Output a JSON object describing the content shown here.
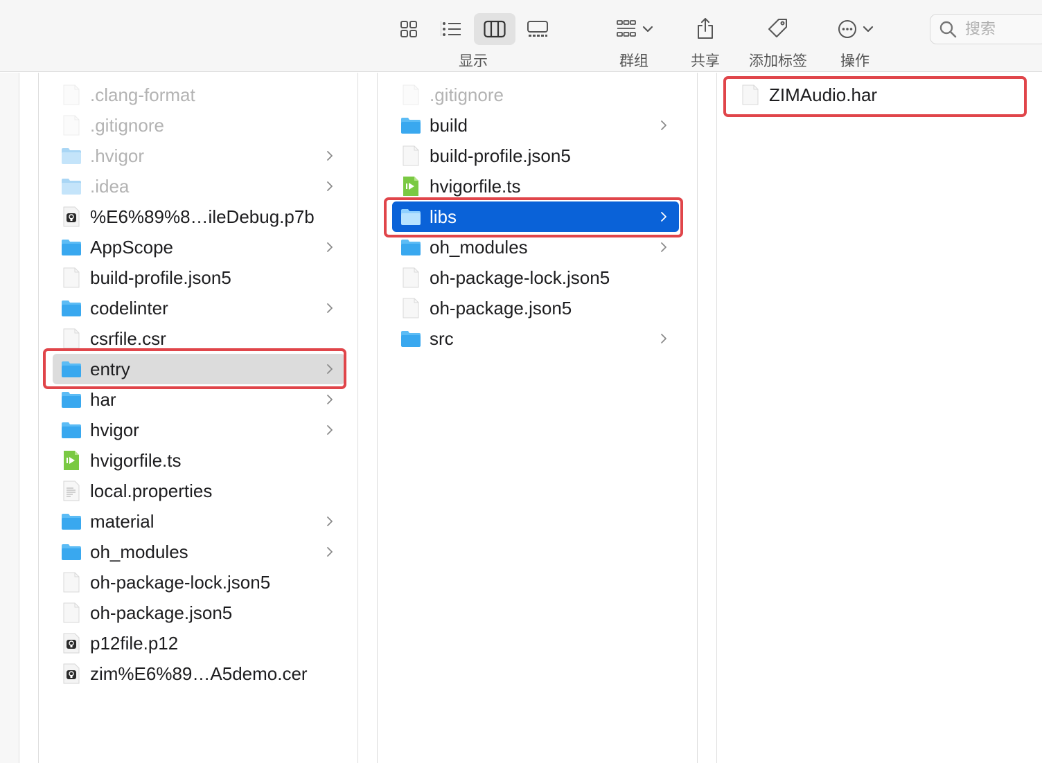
{
  "toolbar": {
    "view_label": "显示",
    "group_label": "群组",
    "share_label": "共享",
    "tag_label": "添加标签",
    "action_label": "操作",
    "search_placeholder": "搜索"
  },
  "columns": [
    {
      "items": [
        {
          "name": ".clang-format",
          "kind": "file",
          "dim": true
        },
        {
          "name": ".gitignore",
          "kind": "file",
          "dim": true
        },
        {
          "name": ".hvigor",
          "kind": "folder",
          "dim": true,
          "chevron": true
        },
        {
          "name": ".idea",
          "kind": "folder",
          "dim": true,
          "chevron": true
        },
        {
          "name": "%E6%89%8…ileDebug.p7b",
          "kind": "cert"
        },
        {
          "name": "AppScope",
          "kind": "folder",
          "chevron": true
        },
        {
          "name": "build-profile.json5",
          "kind": "file"
        },
        {
          "name": "codelinter",
          "kind": "folder",
          "chevron": true
        },
        {
          "name": "csrfile.csr",
          "kind": "file"
        },
        {
          "name": "entry",
          "kind": "folder",
          "chevron": true,
          "selected": "gray"
        },
        {
          "name": "har",
          "kind": "folder",
          "chevron": true
        },
        {
          "name": "hvigor",
          "kind": "folder",
          "chevron": true
        },
        {
          "name": "hvigorfile.ts",
          "kind": "ts"
        },
        {
          "name": "local.properties",
          "kind": "text"
        },
        {
          "name": "material",
          "kind": "folder",
          "chevron": true
        },
        {
          "name": "oh_modules",
          "kind": "folder",
          "chevron": true
        },
        {
          "name": "oh-package-lock.json5",
          "kind": "file"
        },
        {
          "name": "oh-package.json5",
          "kind": "file"
        },
        {
          "name": "p12file.p12",
          "kind": "cert"
        },
        {
          "name": "zim%E6%89…A5demo.cer",
          "kind": "cert"
        }
      ]
    },
    {
      "items": [
        {
          "name": ".gitignore",
          "kind": "file",
          "dim": true
        },
        {
          "name": "build",
          "kind": "folder",
          "chevron": true
        },
        {
          "name": "build-profile.json5",
          "kind": "file"
        },
        {
          "name": "hvigorfile.ts",
          "kind": "ts"
        },
        {
          "name": "libs",
          "kind": "folder",
          "chevron": true,
          "selected": "blue"
        },
        {
          "name": "oh_modules",
          "kind": "folder",
          "chevron": true
        },
        {
          "name": "oh-package-lock.json5",
          "kind": "file"
        },
        {
          "name": "oh-package.json5",
          "kind": "file"
        },
        {
          "name": "src",
          "kind": "folder",
          "chevron": true
        }
      ]
    },
    {
      "items": [
        {
          "name": "ZIMAudio.har",
          "kind": "file"
        }
      ]
    }
  ],
  "colors": {
    "selection_blue": "#0a62d8",
    "selection_gray": "#dcdcdc",
    "highlight_red": "#e0454a",
    "folder_blue": "#39a8ef"
  }
}
